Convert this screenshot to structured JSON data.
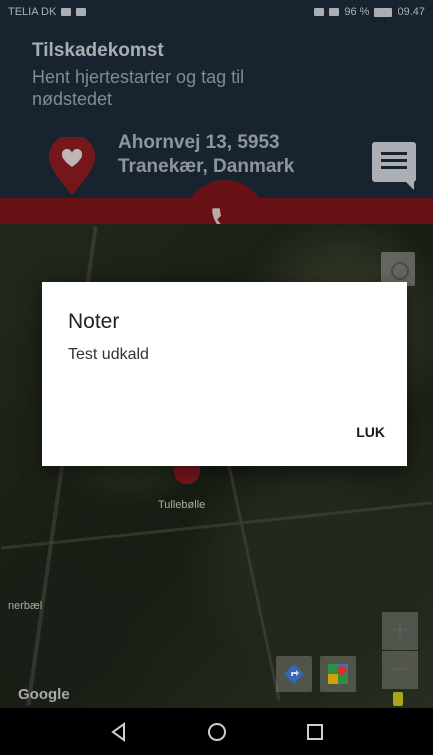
{
  "status_bar": {
    "carrier": "TELIA DK",
    "battery": "96 %",
    "time": "09.47"
  },
  "header": {
    "title": "Tilskadekomst",
    "subtitle": "Hent hjertestarter og tag til nødstedet",
    "address_line1": "Ahornvej 13, 5953",
    "address_line2": "Tranekær, Danmark"
  },
  "map": {
    "town_label": "Tullebølle",
    "area_label": "nerbæl",
    "zoom_in": "+",
    "zoom_out": "−",
    "logo": "Google"
  },
  "dialog": {
    "title": "Noter",
    "body": "Test udkald",
    "close_label": "LUK"
  },
  "icons": {
    "pin": "heart-location-pin-icon",
    "note": "message-icon",
    "call": "phone-icon",
    "back": "back-triangle-icon",
    "home": "home-circle-icon",
    "recents": "recents-square-icon"
  },
  "colors": {
    "header_bg": "#1c2a38",
    "accent_red": "#7a1418",
    "dialog_bg": "#ffffff"
  }
}
